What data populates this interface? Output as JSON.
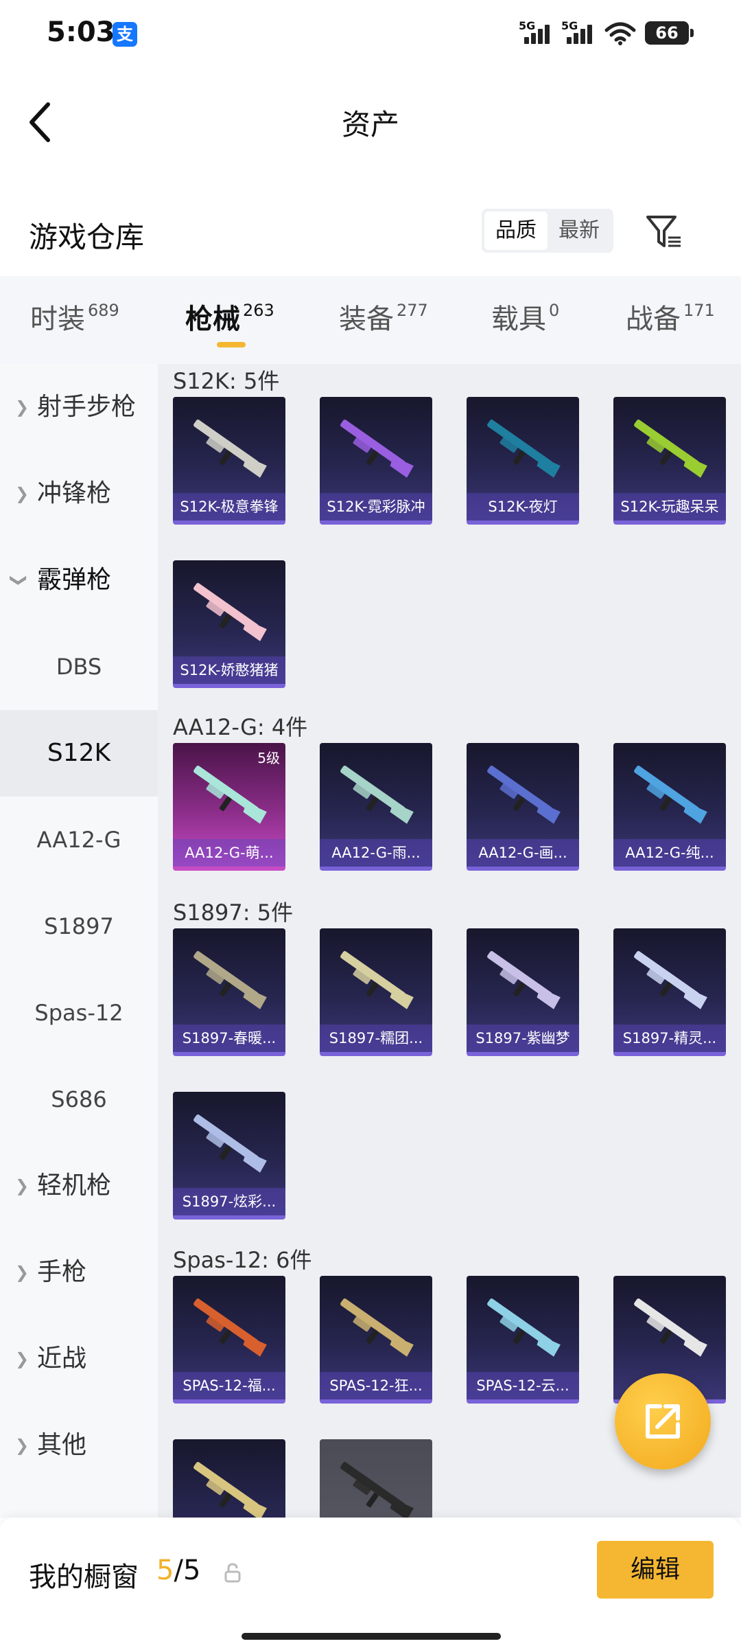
{
  "status_bar": {
    "time": "5:03",
    "alipay_icon": "支",
    "battery": "66",
    "signal1": "5G",
    "signal2": "5G"
  },
  "header": {
    "title": "资产"
  },
  "warehouse": {
    "title": "游戏仓库",
    "sort_options": [
      "品质",
      "最新"
    ],
    "active_sort": "品质"
  },
  "category_tabs": [
    {
      "label": "时装",
      "count": "689"
    },
    {
      "label": "枪械",
      "count": "263",
      "active": true
    },
    {
      "label": "装备",
      "count": "277"
    },
    {
      "label": "载具",
      "count": "0"
    },
    {
      "label": "战备",
      "count": "171"
    }
  ],
  "side_nav": [
    {
      "label": "射手步枪",
      "type": "group",
      "expanded": false
    },
    {
      "label": "冲锋枪",
      "type": "group",
      "expanded": false
    },
    {
      "label": "霰弹枪",
      "type": "group",
      "expanded": true
    },
    {
      "label": "DBS",
      "type": "sub"
    },
    {
      "label": "S12K",
      "type": "sub",
      "active": true
    },
    {
      "label": "AA12-G",
      "type": "sub"
    },
    {
      "label": "S1897",
      "type": "sub"
    },
    {
      "label": "Spas-12",
      "type": "sub"
    },
    {
      "label": "S686",
      "type": "sub"
    },
    {
      "label": "轻机枪",
      "type": "group",
      "expanded": false
    },
    {
      "label": "手枪",
      "type": "group",
      "expanded": false
    },
    {
      "label": "近战",
      "type": "group",
      "expanded": false
    },
    {
      "label": "其他",
      "type": "group",
      "expanded": false
    }
  ],
  "sections": [
    {
      "title": "S12K: 5件",
      "items": [
        {
          "name": "S12K-极意拳锋",
          "color": "#cfcfc8"
        },
        {
          "name": "S12K-霓彩脉冲",
          "color": "#9a5ee0"
        },
        {
          "name": "S12K-夜灯",
          "color": "#1e7fa0"
        },
        {
          "name": "S12K-玩趣呆呆",
          "color": "#9acd32"
        },
        {
          "name": "S12K-娇憨猪猪",
          "color": "#f3c2cf"
        }
      ]
    },
    {
      "title": "AA12-G: 4件",
      "items": [
        {
          "name": "AA12-G-萌...",
          "color": "#a9e6d9",
          "level": "5级"
        },
        {
          "name": "AA12-G-雨...",
          "color": "#a6d4c8"
        },
        {
          "name": "AA12-G-画...",
          "color": "#5a6fd0"
        },
        {
          "name": "AA12-G-纯...",
          "color": "#4fa3e0"
        }
      ]
    },
    {
      "title": "S1897: 5件",
      "items": [
        {
          "name": "S1897-春暖...",
          "color": "#b0a888"
        },
        {
          "name": "S1897-糯团...",
          "color": "#d6cfa0"
        },
        {
          "name": "S1897-紫幽梦",
          "color": "#c8c0e6"
        },
        {
          "name": "S1897-精灵...",
          "color": "#c9d3f0"
        },
        {
          "name": "S1897-炫彩...",
          "color": "#aebde6"
        }
      ]
    },
    {
      "title": "Spas-12: 6件",
      "items": [
        {
          "name": "SPAS-12-福...",
          "color": "#d8602e"
        },
        {
          "name": "SPAS-12-狂...",
          "color": "#c9b070"
        },
        {
          "name": "SPAS-12-云...",
          "color": "#8ed0e6"
        },
        {
          "name": "",
          "color": "#e6e6e6"
        },
        {
          "name": "",
          "color": "#d8c680"
        },
        {
          "name": "",
          "color": "#2a2a2a"
        }
      ]
    }
  ],
  "showcase": {
    "label": "我的橱窗",
    "current": "5",
    "separator": "/",
    "total": "5",
    "edit_label": "编辑"
  }
}
